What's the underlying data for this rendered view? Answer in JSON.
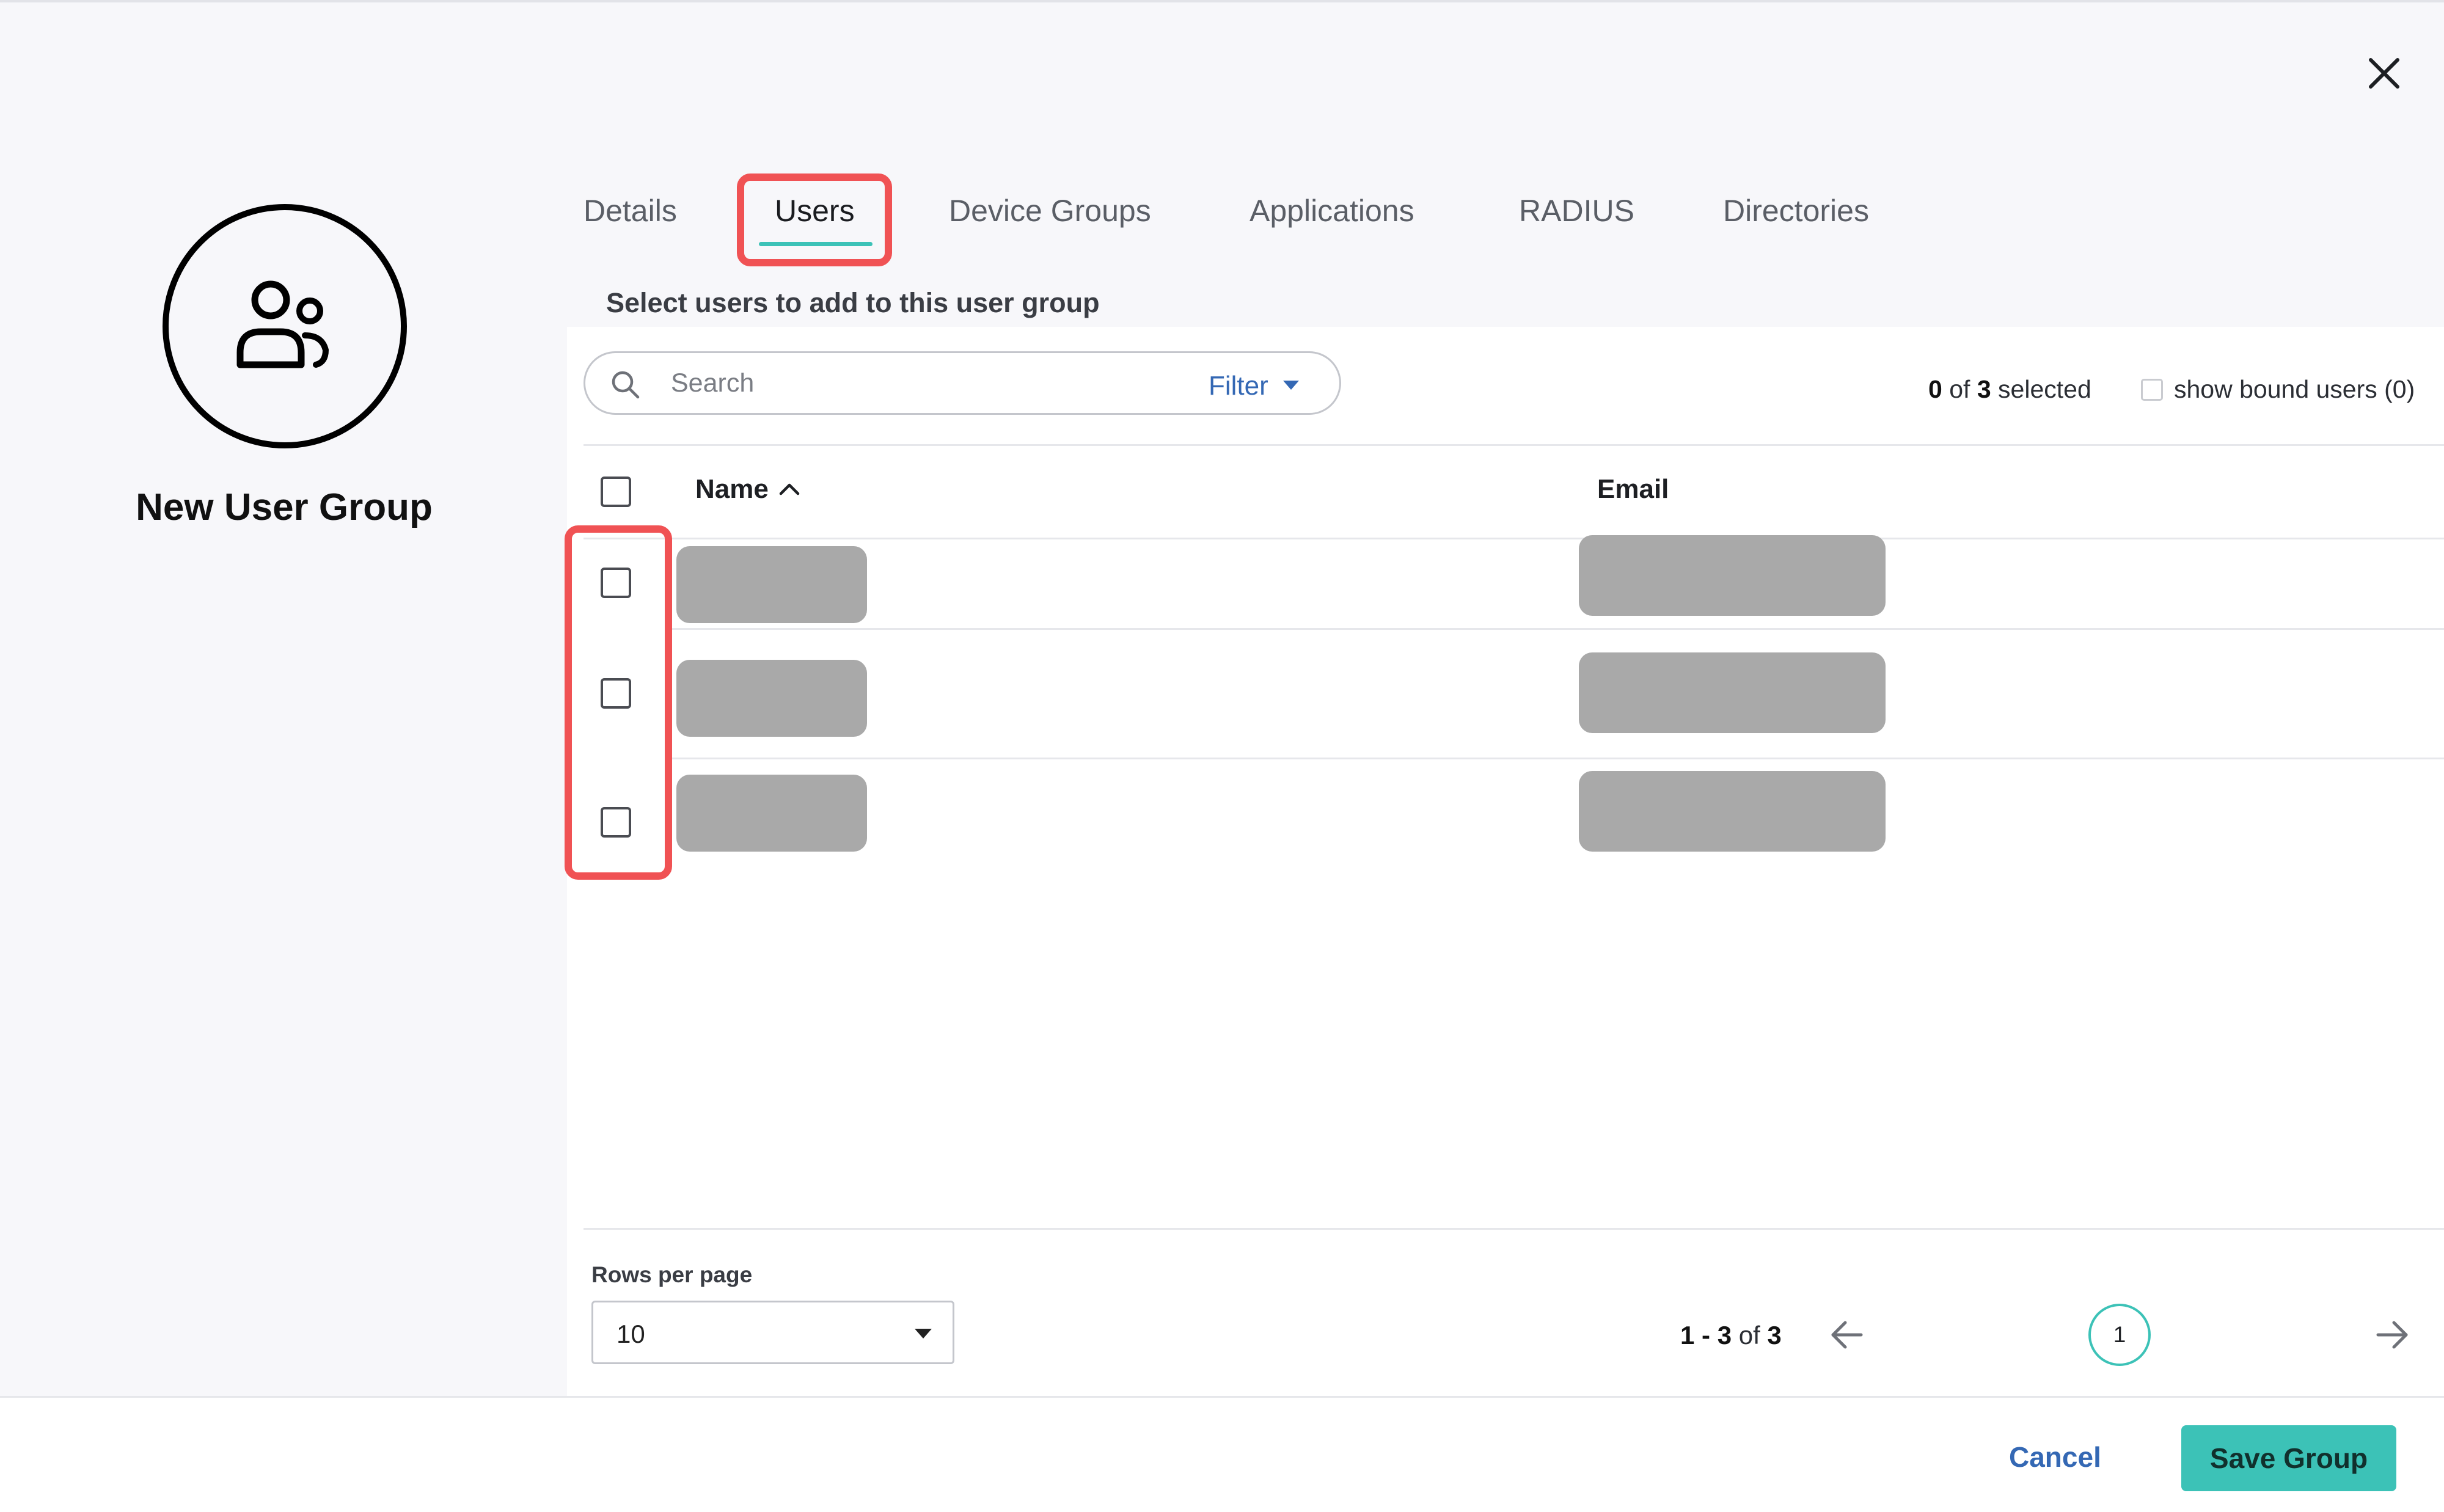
{
  "dialog": {
    "close_icon": "close-icon"
  },
  "group": {
    "icon": "user-group-icon",
    "title": "New User Group"
  },
  "tabs": [
    {
      "label": "Details",
      "active": false
    },
    {
      "label": "Users",
      "active": true
    },
    {
      "label": "Device Groups",
      "active": false
    },
    {
      "label": "Applications",
      "active": false
    },
    {
      "label": "RADIUS",
      "active": false
    },
    {
      "label": "Directories",
      "active": false
    }
  ],
  "users_panel": {
    "instruction": "Select users to add to this user group",
    "search": {
      "placeholder": "Search",
      "value": "",
      "icon": "search-icon"
    },
    "filter_label": "Filter",
    "selection": {
      "selected": "0",
      "of_word": "of",
      "total": "3",
      "suffix": "selected"
    },
    "show_bound": {
      "label": "show bound users (0)",
      "checked": false
    },
    "columns": {
      "name": "Name",
      "email": "Email",
      "sort_icon": "chevron-up-icon"
    },
    "rows": [
      {
        "name": "[redacted]",
        "email": "[redacted]",
        "checked": false
      },
      {
        "name": "[redacted]",
        "email": "[redacted]",
        "checked": false
      },
      {
        "name": "[redacted]",
        "email": "[redacted]",
        "checked": false
      }
    ]
  },
  "pagination": {
    "rows_per_page_label": "Rows per page",
    "rows_per_page_value": "10",
    "range_start": "1",
    "range_sep": " - ",
    "range_end": "3",
    "of_word": "of",
    "range_total": "3",
    "current_page": "1",
    "prev_icon": "arrow-left-icon",
    "next_icon": "arrow-right-icon"
  },
  "footer": {
    "cancel_label": "Cancel",
    "save_label": "Save Group"
  },
  "colors": {
    "accent": "#3cc2b7",
    "link": "#3468b4",
    "highlight": "#f05254",
    "redaction": "#a9a9a9"
  }
}
